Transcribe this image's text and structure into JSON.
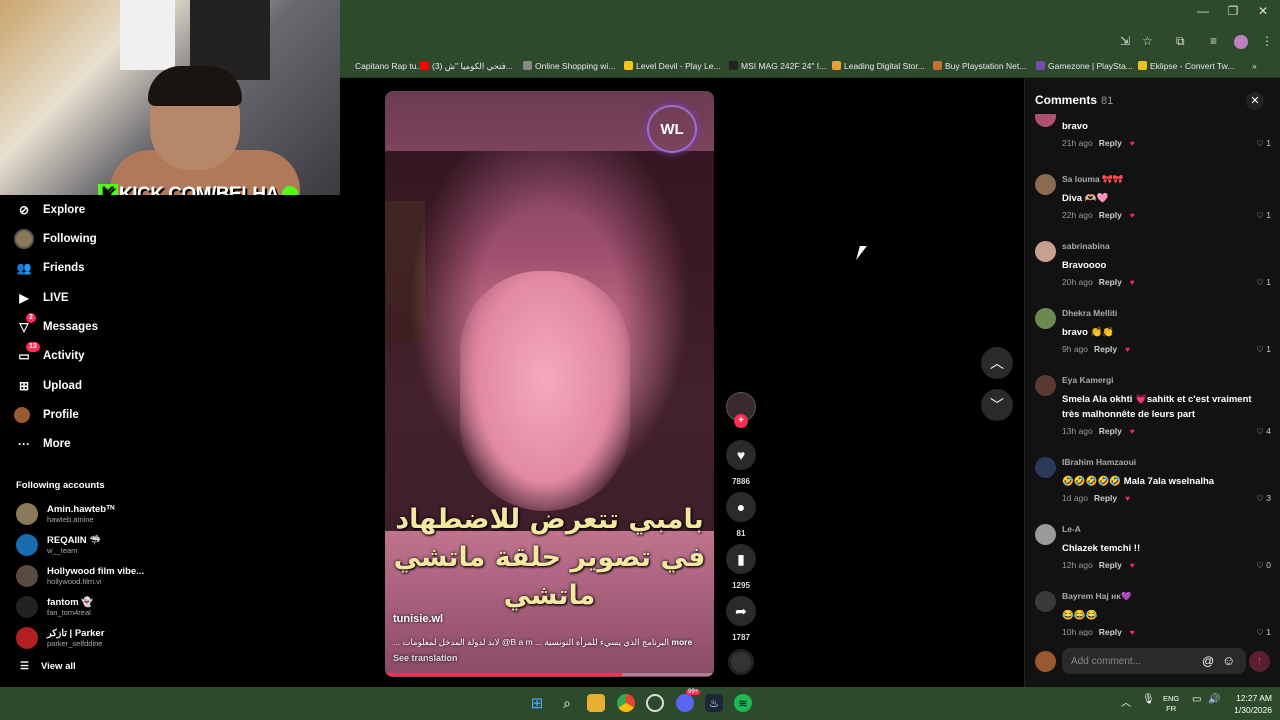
{
  "browser": {
    "bookmarks": [
      {
        "label": "Capitano Rap tu...",
        "color": "#2e4a2c"
      },
      {
        "label": "(3) فتحي الكوميا \"ش...",
        "color": "#ff0000"
      },
      {
        "label": "Online Shopping wi...",
        "color": "#888888"
      },
      {
        "label": "Level Devil - Play Le...",
        "color": "#f5c518"
      },
      {
        "label": "MSI MAG 242F 24\" I...",
        "color": "#222222"
      },
      {
        "label": "Leading Digital Stor...",
        "color": "#e8a030"
      },
      {
        "label": "Buy Playstation Net...",
        "color": "#c87030"
      },
      {
        "label": "Gamezone | PlaySta...",
        "color": "#7a4ab0"
      },
      {
        "label": "Eklipse - Convert Tw...",
        "color": "#f0c020"
      }
    ],
    "more": "»"
  },
  "overlay": {
    "kick_text": "KICK.COM/BELHA",
    "kick_letter": "K"
  },
  "nav": [
    {
      "label": "Explore",
      "icon": "compass-icon",
      "glyph": "⊘"
    },
    {
      "label": "Following",
      "icon": "following-avatar-icon",
      "glyph": ""
    },
    {
      "label": "Friends",
      "icon": "friends-icon",
      "glyph": "👥"
    },
    {
      "label": "LIVE",
      "icon": "live-icon",
      "glyph": "▶"
    },
    {
      "label": "Messages",
      "icon": "messages-icon",
      "glyph": "▽",
      "badge": "2"
    },
    {
      "label": "Activity",
      "icon": "activity-icon",
      "glyph": "▭",
      "badge": "13"
    },
    {
      "label": "Upload",
      "icon": "upload-icon",
      "glyph": "⊞"
    },
    {
      "label": "Profile",
      "icon": "profile-icon",
      "glyph": ""
    },
    {
      "label": "More",
      "icon": "more-icon",
      "glyph": "···"
    }
  ],
  "following_accounts": {
    "title": "Following accounts",
    "items": [
      {
        "name": "Amin.hawtebᵀᴺ",
        "handle": "hawteb.amine",
        "color": "#8a7a5a"
      },
      {
        "name": "REQAIIN 🦈",
        "handle": "w__team",
        "color": "#1a6ab0"
      },
      {
        "name": "Hollywood film vibe...",
        "handle": "hollywood.film.vi",
        "color": "#5a4a40"
      },
      {
        "name": "fantom 👻",
        "handle": "fan_tom4real",
        "color": "#222222"
      },
      {
        "name": "تازكر | Parker",
        "handle": "parker_selfddine",
        "color": "#b02020"
      }
    ],
    "view_all": "View all"
  },
  "video": {
    "caption": "بامبي تتعرض للاضطهاد في تصوير حلقة ماتشي ماتشي",
    "logo": "WL",
    "author": "tunisie.wl",
    "description": "... لابد لدولة المدخل لمعلومات @B a m ... البرنامج الذي يسيء للمرأة التونسية",
    "more": "more",
    "see_translation": "See translation",
    "progress": 0.72
  },
  "actions": {
    "likes": "7886",
    "comments": "81",
    "saves": "1295",
    "shares": "1787"
  },
  "comments_panel": {
    "title": "Comments",
    "count": "81",
    "items": [
      {
        "user": "",
        "text": "bravo",
        "time": "21h ago",
        "likes": "1",
        "color": "#b05070"
      },
      {
        "user": "Sa louma 🎀🎀",
        "text": "Diva 🫶🏼🩷",
        "time": "22h ago",
        "likes": "1",
        "color": "#8a6a50"
      },
      {
        "user": "sabrinabina",
        "text": "Bravoooo",
        "time": "20h ago",
        "likes": "1",
        "color": "#c8a090"
      },
      {
        "user": "Dhekra Melliti",
        "text": "bravo 👏👏",
        "time": "9h ago",
        "likes": "1",
        "color": "#6a8a50"
      },
      {
        "user": "Eya Kamergi",
        "text": "Smela Ala okhti 💗sahitk et c'est vraiment très malhonnête de leurs part",
        "time": "13h ago",
        "likes": "4",
        "color": "#5a3a30"
      },
      {
        "user": "IBrahim Hamzaoui",
        "text": "🤣🤣🤣🤣🤣 Mala 7ala wselnalha",
        "time": "1d ago",
        "likes": "3",
        "color": "#2a3a5a"
      },
      {
        "user": "Le-A",
        "text": "Chlazek temchi !!",
        "time": "12h ago",
        "likes": "0",
        "color": "#9a9a9a"
      },
      {
        "user": "Bayrem Haj ʜᴋ💜",
        "text": "😂😂😂",
        "time": "10h ago",
        "likes": "1",
        "color": "#3a3a3a"
      }
    ],
    "reply_label": "Reply",
    "placeholder": "Add comment...",
    "at": "@",
    "emoji": "☺"
  },
  "taskbar": {
    "lang_top": "ENG",
    "lang_bottom": "FR",
    "time": "12:27 AM",
    "date": "1/30/2026",
    "notif_badge": "99+"
  },
  "colors": {
    "accent": "#fe2c55",
    "kick_green": "#53fc18",
    "chrome_green": "#2e4a2c"
  }
}
